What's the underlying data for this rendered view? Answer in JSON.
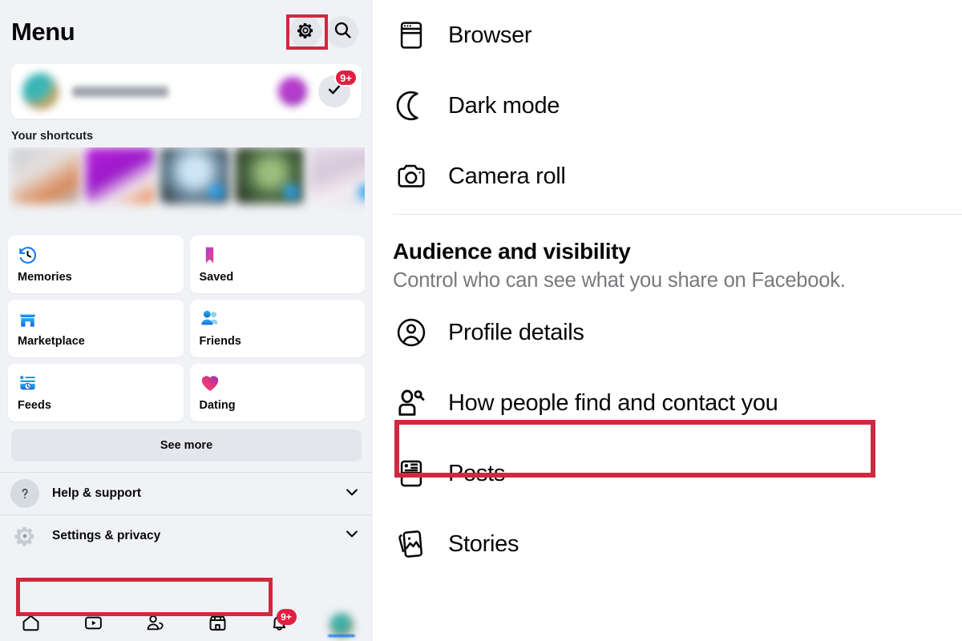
{
  "left_panel": {
    "title": "Menu",
    "header_icons": [
      {
        "name": "gear-icon",
        "glyph": "settings",
        "highlighted": true
      },
      {
        "name": "search-icon",
        "glyph": "search",
        "highlighted": false
      }
    ],
    "profile_card": {
      "name_redacted": "",
      "avatar": "user-avatar",
      "story_dot": "story-avatar",
      "check_badge_count": "9+",
      "check_icon": "check-icon"
    },
    "shortcuts_label": "Your shortcuts",
    "shortcuts": [
      {
        "caption_redacted": "",
        "thumb": "shortcut-thumb-1",
        "has_bubble": false
      },
      {
        "caption_redacted": "",
        "thumb": "shortcut-thumb-2",
        "has_bubble": false
      },
      {
        "caption_redacted": "",
        "thumb": "shortcut-thumb-3",
        "has_bubble": true
      },
      {
        "caption_redacted": "",
        "thumb": "shortcut-thumb-4",
        "has_bubble": true
      },
      {
        "caption_redacted": "",
        "thumb": "shortcut-thumb-5",
        "has_bubble": true
      }
    ],
    "tiles": [
      {
        "label": "Memories",
        "icon": "memories-clock-icon"
      },
      {
        "label": "Saved",
        "icon": "saved-bookmark-icon"
      },
      {
        "label": "Marketplace",
        "icon": "marketplace-storefront-icon"
      },
      {
        "label": "Friends",
        "icon": "friends-people-icon"
      },
      {
        "label": "Feeds",
        "icon": "feeds-icon"
      },
      {
        "label": "Dating",
        "icon": "dating-heart-icon"
      }
    ],
    "see_more_label": "See more",
    "rows": [
      {
        "label": "Help & support",
        "icon": "question-mark-icon",
        "chevron": "chevron-down-icon",
        "highlighted": false
      },
      {
        "label": "Settings & privacy",
        "icon": "gear-icon",
        "chevron": "chevron-down-icon",
        "highlighted": true
      }
    ],
    "bottom_nav": [
      {
        "name": "home-icon",
        "badge": ""
      },
      {
        "name": "video-icon",
        "badge": ""
      },
      {
        "name": "friends-icon",
        "badge": ""
      },
      {
        "name": "marketplace-icon",
        "badge": ""
      },
      {
        "name": "notifications-bell-icon",
        "badge": "9+"
      },
      {
        "name": "profile-avatar",
        "badge": ""
      }
    ]
  },
  "right_panel": {
    "top_items": [
      {
        "label": "Browser",
        "icon": "browser-window-icon"
      },
      {
        "label": "Dark mode",
        "icon": "moon-icon"
      },
      {
        "label": "Camera roll",
        "icon": "camera-icon"
      }
    ],
    "section": {
      "title": "Audience and visibility",
      "subtitle": "Control who can see what you share on Facebook."
    },
    "section_items": [
      {
        "label": "Profile details",
        "icon": "person-circle-icon",
        "highlighted": false
      },
      {
        "label": "How people find and contact you",
        "icon": "person-search-icon",
        "highlighted": true
      },
      {
        "label": "Posts",
        "icon": "posts-card-icon",
        "highlighted": false
      },
      {
        "label": "Stories",
        "icon": "stories-photo-icon",
        "highlighted": false
      }
    ]
  },
  "colors": {
    "highlight_red": "#d0293f",
    "badge_red": "#e41e3f",
    "panel_bg": "#f0f2f5",
    "accent_blue": "#1877f2",
    "text_primary": "#080809",
    "text_secondary": "#77797d"
  }
}
